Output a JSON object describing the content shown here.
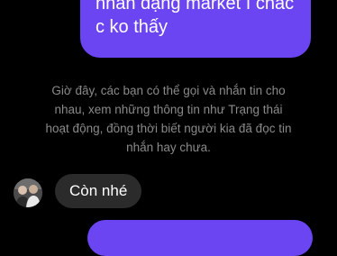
{
  "conversation": {
    "outgoing_top_line1": "nhắn dạng market í chắc",
    "outgoing_top_line2": "c ko thấy",
    "system_note_line1": "Giờ đây, các bạn có thể gọi và nhắn tin cho",
    "system_note_line2": "nhau, xem những thông tin như Trạng thái",
    "system_note_line3": "hoạt động, đồng thời biết người kia đã đọc tin",
    "system_note_line4": "nhắn hay chưa.",
    "incoming_message": "Còn nhé"
  },
  "colors": {
    "outgoing_bubble": "#6b45f2",
    "incoming_bubble": "#2b2b2b",
    "system_text": "#8a8a8a",
    "background": "#000000"
  }
}
